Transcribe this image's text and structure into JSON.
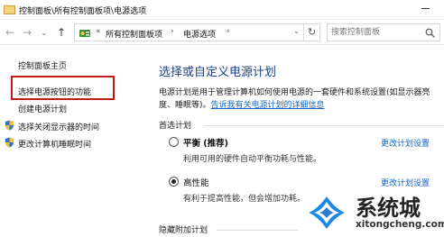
{
  "window": {
    "title": "控制面板\\所有控制面板项\\电源选项"
  },
  "address_bar": {
    "chevron": "«",
    "crumbs": [
      "所有控制面板项",
      "电源选项"
    ],
    "separator": "›",
    "dropdown": "⌄",
    "refresh": "↻"
  },
  "nav": {
    "back": "←",
    "forward": "→",
    "recent": "⌄",
    "up": "↑"
  },
  "search": {
    "placeholder": "搜索控制面板"
  },
  "sidebar": {
    "items": [
      {
        "label": "控制面板主页"
      },
      {
        "label": "选择电源按钮的功能",
        "highlighted": true
      },
      {
        "label": "创建电源计划"
      },
      {
        "label": "选择关闭显示器的时间",
        "icon": "shield-icon"
      },
      {
        "label": "更改计算机睡眠时间",
        "icon": "shield-icon"
      }
    ],
    "highlight_color": "#c51a1a"
  },
  "main": {
    "title": "选择或自定义电源计划",
    "description_line1": "电源计划是用于管理计算机如何使用电源的一套硬件和系统设置(如显示器亮",
    "description_line2_prefix": "度、睡眠等)。",
    "description_link": "告诉我有关电源计划的详细信息",
    "preferred_group_label": "首选计划",
    "plans": [
      {
        "name": "平衡 (推荐)",
        "description": "利用可用的硬件自动平衡功耗与性能。",
        "selected": false,
        "change_link": "更改计划设置"
      },
      {
        "name": "高性能",
        "description": "有利于提高性能，但会增加功耗。",
        "selected": true,
        "change_link": "更改计划设置"
      }
    ],
    "hidden_group_label": "隐藏附加计划"
  },
  "watermark": {
    "text": "系统城",
    "url": "xitongcheng.com",
    "logo_colors": [
      "#1e88e5",
      "#2e7bd6"
    ]
  },
  "colors": {
    "title_blue": "#1b3f8c",
    "link_blue": "#1566c0"
  }
}
